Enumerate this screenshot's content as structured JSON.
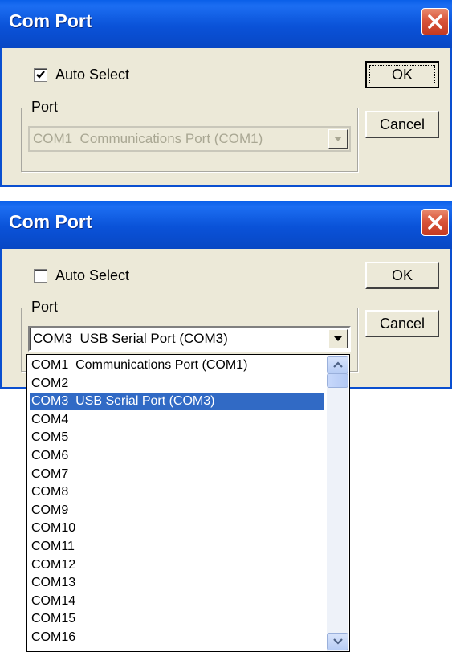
{
  "dialog1": {
    "title": "Com Port",
    "auto_select_label": "Auto Select",
    "auto_select_checked": true,
    "port_group_label": "Port",
    "port_value": "COM1  Communications Port (COM1)",
    "port_disabled": true,
    "ok_label": "OK",
    "cancel_label": "Cancel"
  },
  "dialog2": {
    "title": "Com Port",
    "auto_select_label": "Auto Select",
    "auto_select_checked": false,
    "port_group_label": "Port",
    "port_value": "COM3  USB Serial Port (COM3)",
    "port_disabled": false,
    "ok_label": "OK",
    "cancel_label": "Cancel"
  },
  "dropdown": {
    "selected_index": 2,
    "options": [
      "COM1  Communications Port (COM1)",
      "COM2",
      "COM3  USB Serial Port (COM3)",
      "COM4",
      "COM5",
      "COM6",
      "COM7",
      "COM8",
      "COM9",
      "COM10",
      "COM11",
      "COM12",
      "COM13",
      "COM14",
      "COM15",
      "COM16"
    ]
  },
  "icons": {
    "close": "close-icon",
    "checkmark": "checkmark-icon",
    "dropdown_arrow": "chevron-down-icon",
    "scroll_up": "scroll-up-icon",
    "scroll_down": "scroll-down-icon"
  },
  "colors": {
    "titlebar": "#0a52d8",
    "close_button": "#d9553a",
    "dialog_background": "#ece9d8",
    "selection": "#316ac5"
  }
}
